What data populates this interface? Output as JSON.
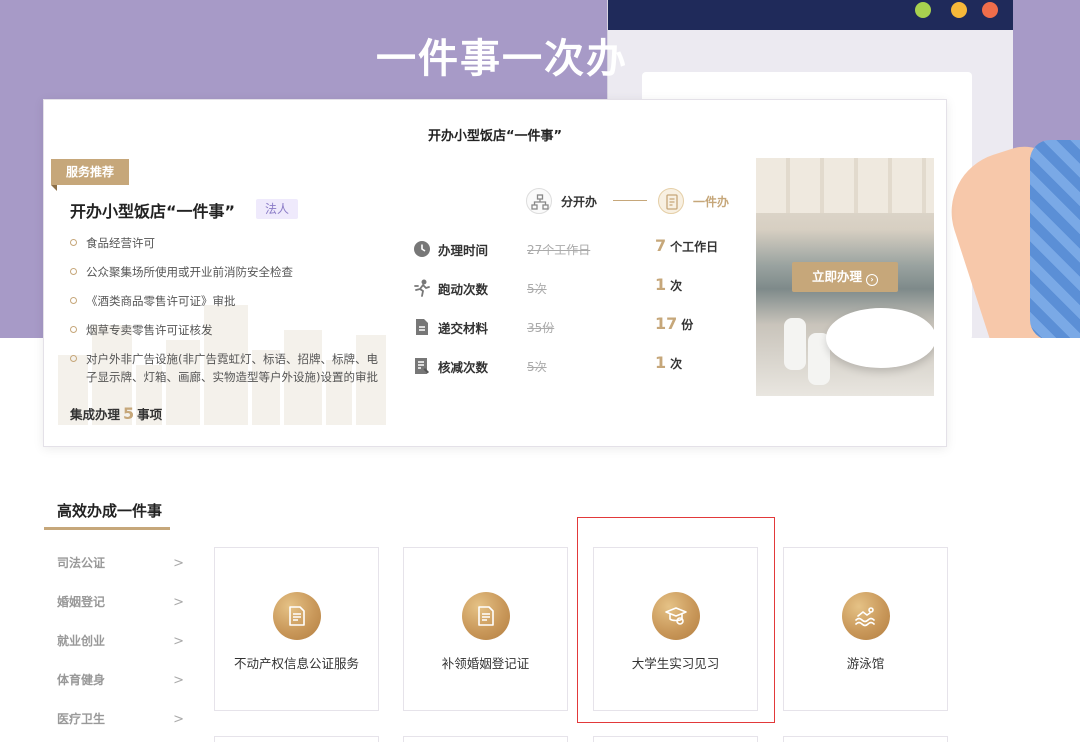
{
  "hero": {
    "title": "一件事一次办"
  },
  "card": {
    "heading": "开办小型饭店“一件事”",
    "ribbon": "服务推荐",
    "service_title": "开办小型饭店“一件事”",
    "service_tag": "法人",
    "items": [
      "食品经营许可",
      "公众聚集场所使用或开业前消防安全检查",
      "《酒类商品零售许可证》审批",
      "烟草专卖零售许可证核发",
      "对户外非广告设施(非广告霓虹灯、标语、招牌、标牌、电子显示牌、灯箱、画廊、实物造型等户外设施)设置的审批"
    ],
    "count_prefix": "集成办理",
    "count_num": "5",
    "count_suffix": "事项",
    "flow": {
      "from_label": "分开办",
      "to_label": "一件办"
    },
    "stats": [
      {
        "label": "办理时间",
        "old": "27个工作日",
        "new_num": "7",
        "new_unit": "个工作日",
        "icon": "clock-icon"
      },
      {
        "label": "跑动次数",
        "old": "5次",
        "new_num": "1",
        "new_unit": "次",
        "icon": "running-icon"
      },
      {
        "label": "递交材料",
        "old": "35份",
        "new_num": "17",
        "new_unit": "份",
        "icon": "document-icon"
      },
      {
        "label": "核减次数",
        "old": "5次",
        "new_num": "1",
        "new_unit": "次",
        "icon": "form-icon"
      }
    ],
    "apply_label": "立即办理"
  },
  "section": {
    "title": "高效办成一件事",
    "categories": [
      "司法公证",
      "婚姻登记",
      "就业创业",
      "体育健身",
      "医疗卫生"
    ],
    "tiles": [
      {
        "label": "不动产权信息公证服务",
        "icon": "document-icon"
      },
      {
        "label": "补领婚姻登记证",
        "icon": "certificate-icon"
      },
      {
        "label": "大学生实习见习",
        "icon": "graduate-icon"
      },
      {
        "label": "游泳馆",
        "icon": "swimming-icon"
      }
    ]
  },
  "colors": {
    "accent": "#c6a77a",
    "hero_bg": "#a79ac7",
    "highlight": "#e2393a"
  }
}
